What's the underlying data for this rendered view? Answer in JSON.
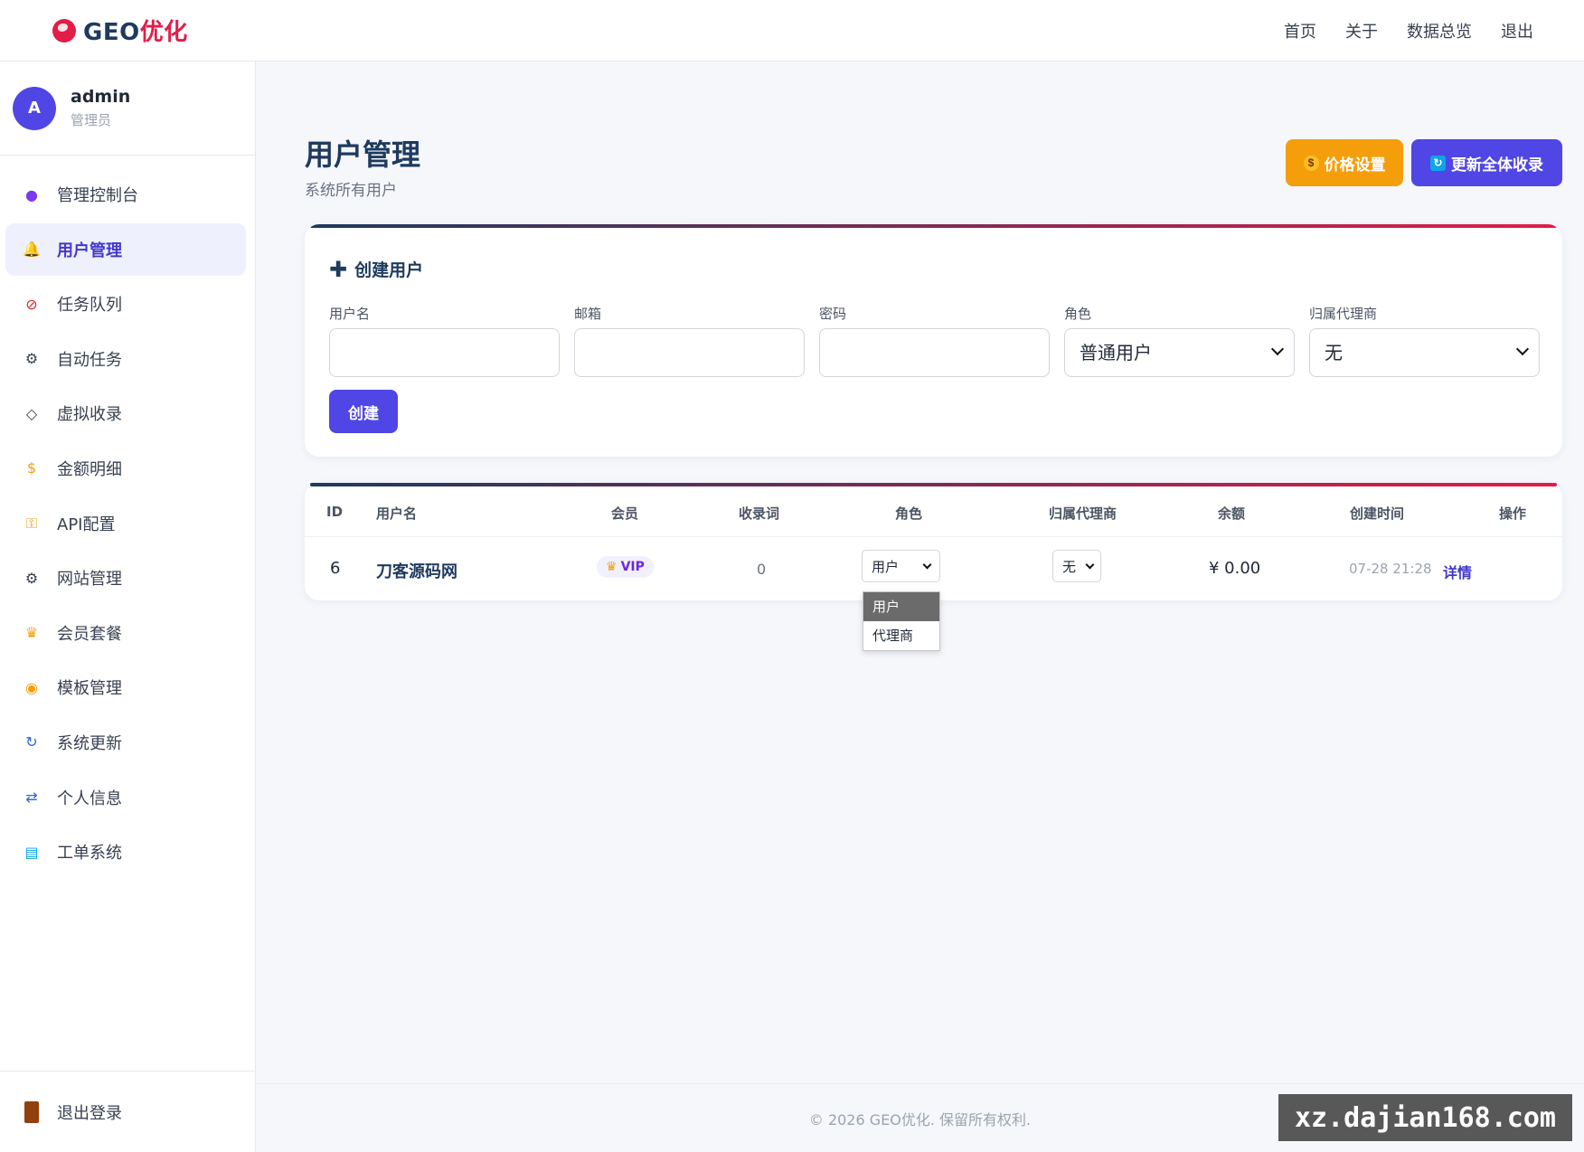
{
  "brand": {
    "name_prefix": "GEO",
    "name_accent": "优化"
  },
  "topnav": [
    "首页",
    "关于",
    "数据总览",
    "退出"
  ],
  "user": {
    "avatar_letter": "A",
    "name": "admin",
    "role": "管理员"
  },
  "sidebar": {
    "items": [
      {
        "label": "管理控制台",
        "icon": "crystal-ball-icon",
        "color": "#7c3aed"
      },
      {
        "label": "用户管理",
        "icon": "bell-icon",
        "color": "#f59e0b",
        "active": true
      },
      {
        "label": "任务队列",
        "icon": "no-entry-icon",
        "color": "#dc2626"
      },
      {
        "label": "自动任务",
        "icon": "gear-icon",
        "color": "#374151"
      },
      {
        "label": "虚拟收录",
        "icon": "tag-icon",
        "color": "#374151"
      },
      {
        "label": "金额明细",
        "icon": "money-bag-icon",
        "color": "#f59e0b"
      },
      {
        "label": "API配置",
        "icon": "key-icon",
        "color": "#f59e0b"
      },
      {
        "label": "网站管理",
        "icon": "gear-icon",
        "color": "#374151"
      },
      {
        "label": "会员套餐",
        "icon": "crown-icon",
        "color": "#f59e0b"
      },
      {
        "label": "模板管理",
        "icon": "palette-icon",
        "color": "#f59e0b"
      },
      {
        "label": "系统更新",
        "icon": "refresh-icon",
        "color": "#2563eb"
      },
      {
        "label": "个人信息",
        "icon": "repeat-icon",
        "color": "#2563eb"
      },
      {
        "label": "工单系统",
        "icon": "ticket-icon",
        "color": "#0ea5e9"
      }
    ],
    "logout": "退出登录"
  },
  "header": {
    "title": "用户管理",
    "subtitle": "系统所有用户",
    "price_button": "价格设置",
    "update_button": "更新全体收录"
  },
  "create_form": {
    "title": "创建用户",
    "username_label": "用户名",
    "email_label": "邮箱",
    "password_label": "密码",
    "role_label": "角色",
    "role_value": "普通用户",
    "agent_label": "归属代理商",
    "agent_value": "无",
    "submit": "创建"
  },
  "table": {
    "headers": [
      "ID",
      "用户名",
      "会员",
      "收录词",
      "角色",
      "归属代理商",
      "余额",
      "创建时间",
      "操作"
    ],
    "rows": [
      {
        "id": "6",
        "username": "刀客源码网",
        "member": "VIP",
        "keywords": "0",
        "role": "用户",
        "agent": "无",
        "balance": "¥ 0.00",
        "created": "07-28 21:28",
        "action": "详情"
      }
    ],
    "role_dropdown": {
      "options": [
        "用户",
        "代理商"
      ],
      "selected": "用户"
    }
  },
  "footer": "© 2026 GEO优化. 保留所有权利.",
  "watermark": "xz.dajian168.com"
}
